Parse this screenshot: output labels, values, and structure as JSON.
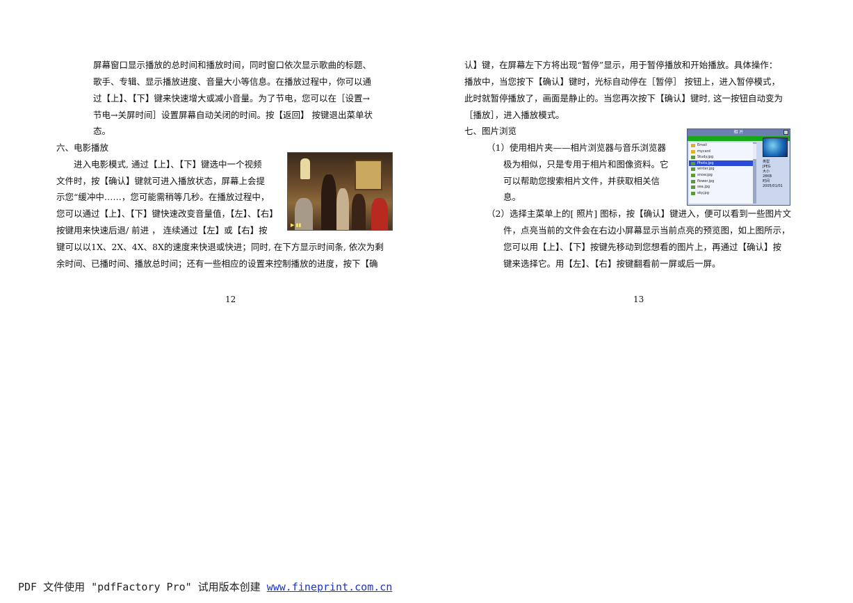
{
  "left_page": {
    "lines": [
      "屏幕窗口显示播放的总时间和播放时间，同时窗口依次显示歌曲的标题、",
      "歌手、专辑、显示播放进度、音量大小等信息。在播放过程中，你可以通",
      "过【上】、【下】键来快速增大或减小音量。为了节电，您可以在［设置→",
      "节电→关屏时间］设置屏幕自动关闭的时间。按【返回】 按键退出菜单状",
      "态。"
    ],
    "section_heading": "六、电影播放",
    "section_lines_short": [
      "进入电影模式, 通过【上】、【下】键选中一个视频",
      "文件时，按【确认】键就可进入播放状态，屏幕上会提",
      "示您“缓冲中……，您可能需稍等几秒。在播放过程中，",
      "您可以通过【上】、【下】键快速改变音量值，【左】、【右】",
      "按键用来快速后退/ 前进 ， 连续通过【左】或【右】按"
    ],
    "section_lines_full": [
      "键可以以1X、2X、4X、8X的速度来快退或快进；同时, 在下方显示时间条, 依次为剩",
      "余时间、已播时间、播放总时间；还有一些相应的设置来控制播放的进度，按下【确"
    ],
    "page_number": "12"
  },
  "right_page": {
    "lines": [
      "认】键，在屏幕左下方将出现“暂停”显示，用于暂停播放和开始播放。具体操作：",
      "播放中，当您按下【确认】键时，光标自动停在［暂停］ 按钮上，进入暂停模式，",
      "此时就暂停播放了，画面是静止的。当您再次按下【确认】键时, 这一按钮自动变为",
      "［播放］，进入播放模式。"
    ],
    "section_heading": "七、图片浏览",
    "item1_lines": [
      "（1）使用相片夹——相片浏览器与音乐浏览器",
      "极为相似，只是专用于相片和图像资料。它",
      "可以帮助您搜索相片文件，并获取相关信",
      "息。"
    ],
    "item2_lines": [
      "（2）选择主菜单上的[ 照片] 图标，按【确认】键进入，便可以看到一些图片文",
      "件，点亮当前的文件会在右边小屏幕显示当前点亮的预览图，如上图所示，",
      "您可以用【上】、【下】按键先移动到您想看的图片上，再通过【确认】按",
      "键来选择它。用【左】、【右】按键翻看前一屏或后一屏。"
    ],
    "page_number": "13",
    "browser": {
      "title": "相 片",
      "rows": [
        "Email",
        "mycard",
        "Study.jpg",
        "Photo.jpg",
        "winter.jpg",
        "snow.jpg",
        "flower.jpg",
        "sea.jpg",
        "sky.jpg"
      ],
      "selected_index": 3,
      "info": [
        "类型",
        "JPEG",
        "大小",
        "28KB",
        "时间",
        "2005/01/01"
      ]
    }
  },
  "footer": {
    "text": "PDF 文件使用 \"pdfFactory Pro\" 试用版本创建 ",
    "link": "www.fineprint.com.cn"
  }
}
